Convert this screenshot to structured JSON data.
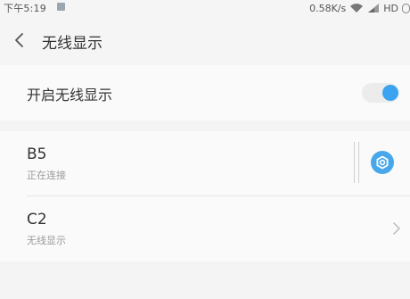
{
  "status_bar": {
    "time": "下午5:19",
    "network_speed": "0.58K/s",
    "network_type": "HD"
  },
  "header": {
    "title": "无线显示"
  },
  "toggle": {
    "label": "开启无线显示",
    "on": true,
    "accent_color": "#3ca3f0"
  },
  "devices": [
    {
      "name": "B5",
      "status": "正在连接"
    },
    {
      "name": "C2",
      "status": "无线显示"
    }
  ],
  "icons": {
    "back": "chevron-left-icon",
    "device_settings": "gear-icon",
    "device_more": "chevron-right-icon"
  }
}
